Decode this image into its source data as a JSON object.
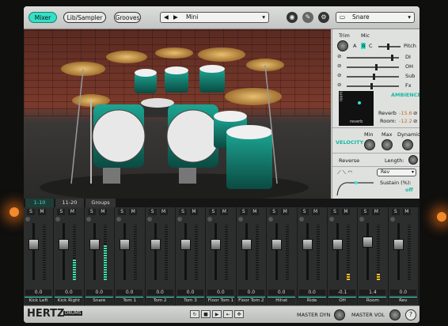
{
  "header": {
    "tabs": [
      {
        "label": "Mixer",
        "active": true
      },
      {
        "label": "Lib/Sampler",
        "active": false
      },
      {
        "label": "Grooves",
        "active": false
      }
    ],
    "preset": "Mini",
    "instrument": "Snare",
    "accent": "#36e3c9"
  },
  "right_panel": {
    "trim_label": "Trim",
    "mic_label": "Mic",
    "mic_buttons": [
      "A",
      "B",
      "C"
    ],
    "sliders": [
      {
        "label": "Pitch",
        "level": 0.4
      },
      {
        "label": "DI",
        "level": 0.85
      },
      {
        "label": "OH",
        "level": 0.55
      },
      {
        "label": "Sub",
        "level": 0.5
      },
      {
        "label": "Fx",
        "level": 0.45
      }
    ],
    "ambience_label": "AMBIENCE",
    "room_label": "room",
    "reverb_label": "reverb",
    "reverb_text": "Reverb",
    "reverb_value": "-15.6",
    "room_text": "Room:",
    "room_value": "-12.2",
    "velocity_label": "VELOCITY",
    "min_label": "Min",
    "max_label": "Max",
    "dynamic_label": "Dynamic",
    "reverse_label": "Reverse",
    "length_label": "Length:",
    "rev_select": "Rev",
    "sustain_label": "Sustain (%):",
    "sustain_value": "off"
  },
  "mixer": {
    "tabs": [
      {
        "label": "1-10",
        "active": true
      },
      {
        "label": "11-20",
        "active": false
      },
      {
        "label": "Groups",
        "active": false
      }
    ],
    "channels": [
      {
        "name": "Kick Left",
        "value": "0.0",
        "meter": 0.0,
        "fader": 0.35
      },
      {
        "name": "Kick Right",
        "value": "0.0",
        "meter": 0.38,
        "fader": 0.35
      },
      {
        "name": "Snare",
        "value": "0.0",
        "meter": 0.65,
        "fader": 0.35
      },
      {
        "name": "Tom 1",
        "value": "0.0",
        "meter": 0.0,
        "fader": 0.35
      },
      {
        "name": "Tom 2",
        "value": "0.0",
        "meter": 0.0,
        "fader": 0.35
      },
      {
        "name": "Tom 3",
        "value": "0.0",
        "meter": 0.0,
        "fader": 0.35
      },
      {
        "name": "Floor Tom 1",
        "value": "0.0",
        "meter": 0.0,
        "fader": 0.35
      },
      {
        "name": "Floor Tom 2",
        "value": "0.0",
        "meter": 0.0,
        "fader": 0.35
      },
      {
        "name": "Hihat",
        "value": "0.0",
        "meter": 0.0,
        "fader": 0.35
      },
      {
        "name": "Ride",
        "value": "0.0",
        "meter": 0.0,
        "fader": 0.35
      },
      {
        "name": "OH",
        "value": "-0.1",
        "meter": 0.12,
        "fader": 0.35
      },
      {
        "name": "Room",
        "value": "1.4",
        "meter": 0.12,
        "fader": 0.3
      },
      {
        "name": "Rev",
        "value": "0.0",
        "meter": 0.0,
        "fader": 0.35
      }
    ],
    "solo_label": "S",
    "mute_label": "M"
  },
  "footer": {
    "brand": "HERTZ",
    "brand_sub": "DRUMS",
    "master_dyn": "MASTER DYN",
    "master_vol": "MASTER VOL",
    "help": "?"
  }
}
